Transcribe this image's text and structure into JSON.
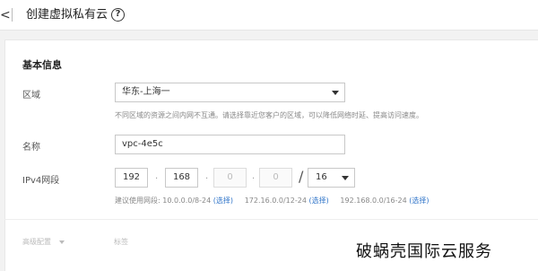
{
  "header": {
    "back_glyph": "<",
    "title": "创建虚拟私有云",
    "help_glyph": "?"
  },
  "basic_info": {
    "section_title": "基本信息",
    "region": {
      "label": "区域",
      "value": "华东-上海一",
      "hint": "不同区域的资源之间内网不互通。请选择靠近您客户的区域，可以降低网络时延、提高访问速度。"
    },
    "name": {
      "label": "名称",
      "value": "vpc-4e5c"
    },
    "ipv4": {
      "label": "IPv4网段",
      "octets": [
        "192",
        "168",
        "0",
        "0"
      ],
      "separator": ".",
      "slash": "/",
      "mask": "16",
      "suggest_prefix": "建议使用网段:",
      "suggestions": [
        {
          "cidr": "10.0.0.0/8-24",
          "link": "(选择)"
        },
        {
          "cidr": "172.16.0.0/12-24",
          "link": "(选择)"
        },
        {
          "cidr": "192.168.0.0/16-24",
          "link": "(选择)"
        }
      ]
    }
  },
  "footer": {
    "advanced_label": "高级配置",
    "tag_label": "标签"
  },
  "watermark": "破蜗壳国际云服务"
}
